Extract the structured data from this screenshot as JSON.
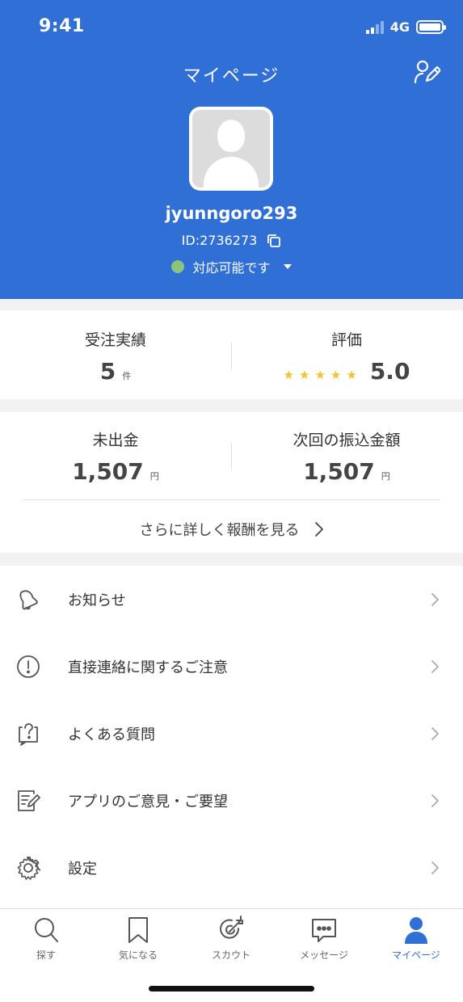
{
  "status_bar": {
    "time": "9:41",
    "network": "4G"
  },
  "header": {
    "title": "マイページ",
    "username": "jyunngoro293",
    "user_id": "ID:2736273",
    "availability": "対応可能です",
    "availability_color": "#8dc37c",
    "background_color": "#2f6fd6"
  },
  "stats": {
    "orders_label": "受注実績",
    "orders_value": "5",
    "orders_unit": "件",
    "rating_label": "評価",
    "rating_value": "5.0",
    "rating_stars": 5,
    "unpaid_label": "未出金",
    "unpaid_value": "1,507",
    "unpaid_unit": "円",
    "next_transfer_label": "次回の振込金額",
    "next_transfer_value": "1,507",
    "next_transfer_unit": "円",
    "more_link": "さらに詳しく報酬を見る"
  },
  "menu": {
    "items": [
      {
        "label": "お知らせ",
        "icon": "bell-icon"
      },
      {
        "label": "直接連絡に関するご注意",
        "icon": "warning-circle-icon"
      },
      {
        "label": "よくある質問",
        "icon": "question-bubble-icon"
      },
      {
        "label": "アプリのご意見・ご要望",
        "icon": "feedback-edit-icon"
      },
      {
        "label": "設定",
        "icon": "gear-icon"
      }
    ]
  },
  "tabbar": {
    "items": [
      {
        "label": "探す",
        "icon": "search-icon"
      },
      {
        "label": "気になる",
        "icon": "bookmark-icon"
      },
      {
        "label": "スカウト",
        "icon": "target-arrow-icon"
      },
      {
        "label": "メッセージ",
        "icon": "chat-bubble-icon"
      },
      {
        "label": "マイページ",
        "icon": "person-icon"
      }
    ],
    "active_index": 4
  }
}
